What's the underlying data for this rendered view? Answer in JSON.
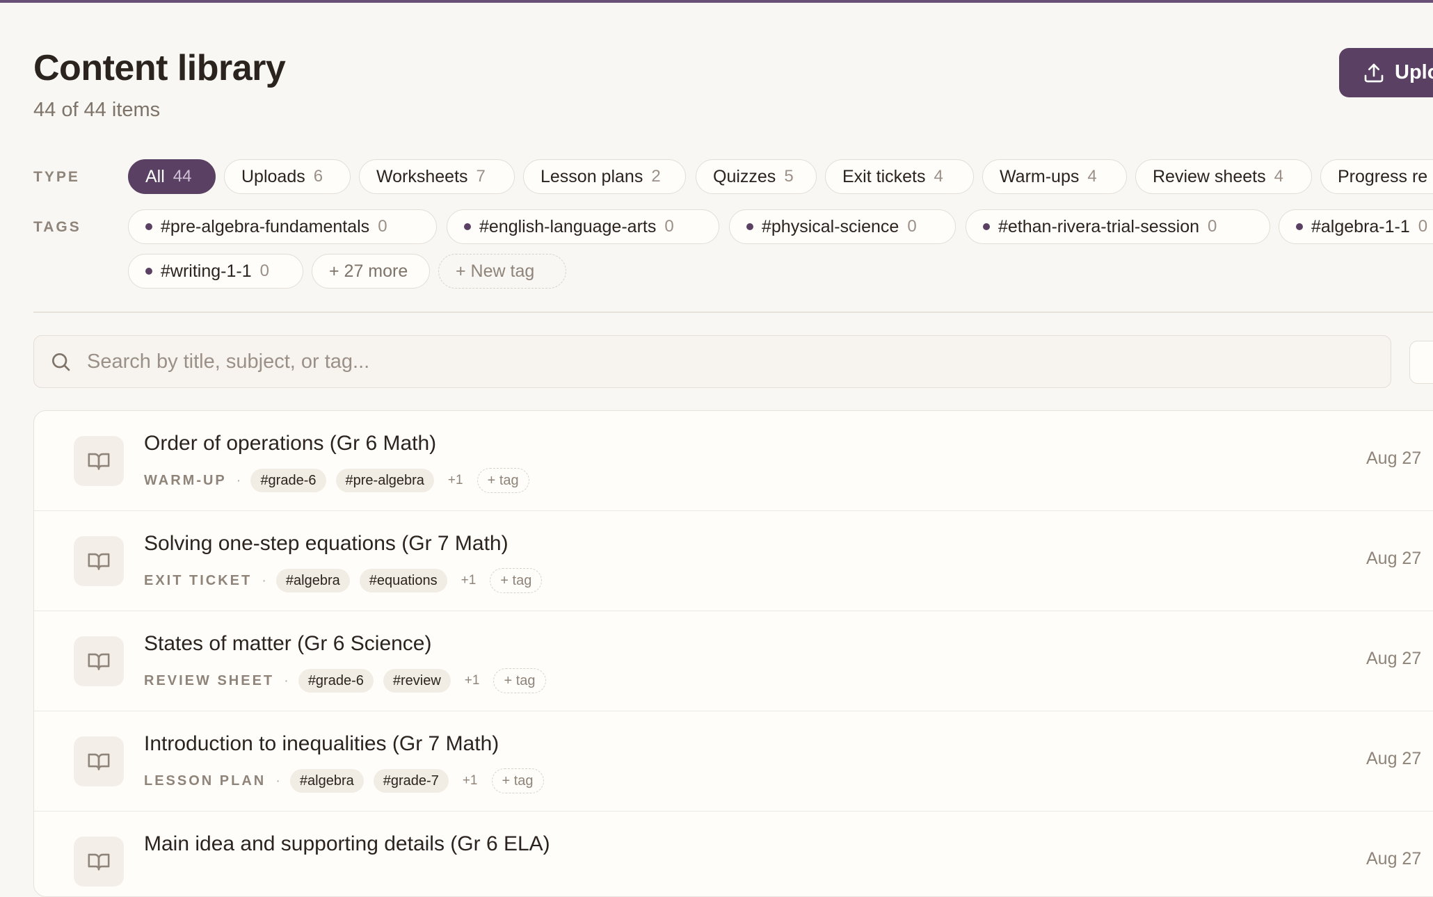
{
  "header": {
    "title": "Content library",
    "count": "44 of 44 items",
    "upload_label": "Uplo"
  },
  "filters": {
    "type_label": "TYPE",
    "tags_label": "TAGS",
    "types": [
      {
        "label": "All",
        "count": "44"
      },
      {
        "label": "Uploads",
        "count": "6"
      },
      {
        "label": "Worksheets",
        "count": "7"
      },
      {
        "label": "Lesson plans",
        "count": "2"
      },
      {
        "label": "Quizzes",
        "count": "5"
      },
      {
        "label": "Exit tickets",
        "count": "4"
      },
      {
        "label": "Warm-ups",
        "count": "4"
      },
      {
        "label": "Review sheets",
        "count": "4"
      },
      {
        "label": "Progress re",
        "count": ""
      }
    ],
    "tags": [
      {
        "label": "#pre-algebra-fundamentals",
        "count": "0"
      },
      {
        "label": "#english-language-arts",
        "count": "0"
      },
      {
        "label": "#physical-science",
        "count": "0"
      },
      {
        "label": "#ethan-rivera-trial-session",
        "count": "0"
      },
      {
        "label": "#algebra-1-1",
        "count": "0"
      },
      {
        "label": "#writing-1-1",
        "count": "0"
      }
    ],
    "more_label": "+ 27 more",
    "new_tag_label": "+ New tag"
  },
  "search": {
    "placeholder": "Search by title, subject, or tag..."
  },
  "items": [
    {
      "title": "Order of operations (Gr 6 Math)",
      "type": "WARM-UP",
      "tags": [
        "#grade-6",
        "#pre-algebra"
      ],
      "extra": "+1",
      "add_tag": "+ tag",
      "date": "Aug 27"
    },
    {
      "title": "Solving one-step equations (Gr 7 Math)",
      "type": "EXIT TICKET",
      "tags": [
        "#algebra",
        "#equations"
      ],
      "extra": "+1",
      "add_tag": "+ tag",
      "date": "Aug 27"
    },
    {
      "title": "States of matter (Gr 6 Science)",
      "type": "REVIEW SHEET",
      "tags": [
        "#grade-6",
        "#review"
      ],
      "extra": "+1",
      "add_tag": "+ tag",
      "date": "Aug 27"
    },
    {
      "title": "Introduction to inequalities (Gr 7 Math)",
      "type": "LESSON PLAN",
      "tags": [
        "#algebra",
        "#grade-7"
      ],
      "extra": "+1",
      "add_tag": "+ tag",
      "date": "Aug 27"
    },
    {
      "title": "Main idea and supporting details (Gr 6 ELA)",
      "date": "Aug 27"
    }
  ],
  "colors": {
    "accent": "#5a4163",
    "background": "#f9f7f3",
    "top_bar": "#6a5178"
  },
  "icons": {
    "upload": "upload-icon",
    "search": "search-icon",
    "item": "book-open-icon"
  }
}
